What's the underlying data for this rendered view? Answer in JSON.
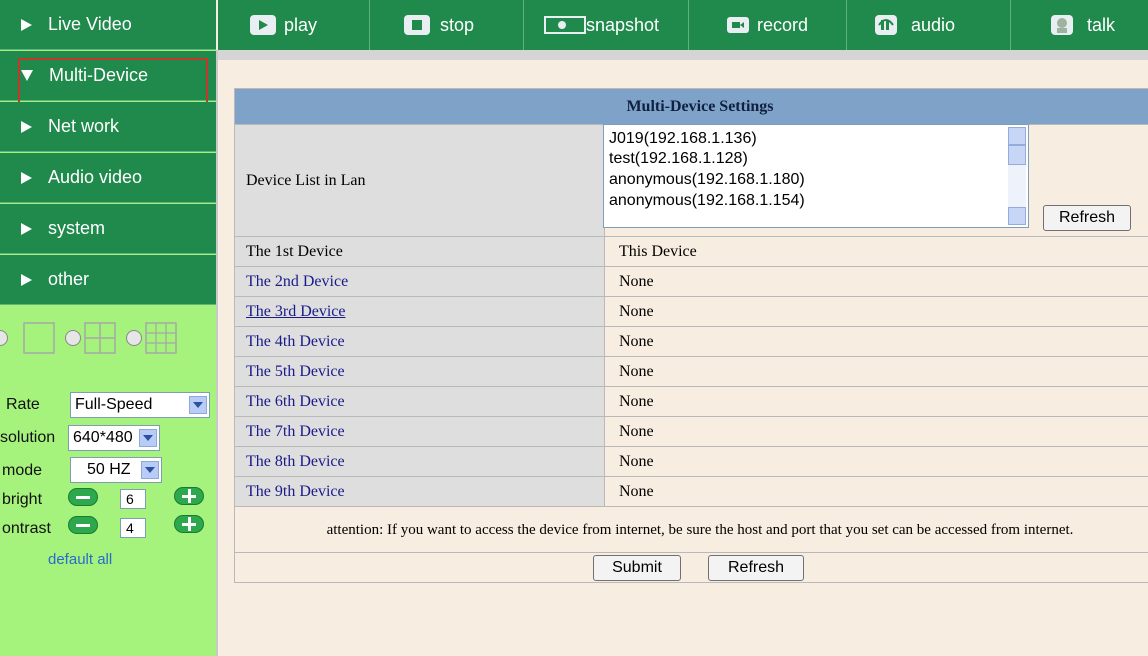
{
  "sidebar": {
    "nav": [
      {
        "label": "Live Video",
        "icon": "triangle-right-icon"
      },
      {
        "label": "Multi-Device",
        "icon": "triangle-down-icon"
      },
      {
        "label": "Net work",
        "icon": "triangle-right-icon"
      },
      {
        "label": "Audio video",
        "icon": "triangle-right-icon"
      },
      {
        "label": "system",
        "icon": "triangle-right-icon"
      },
      {
        "label": "other",
        "icon": "triangle-right-icon"
      }
    ],
    "controls": {
      "rate_label": "Rate",
      "rate_value": "Full-Speed",
      "resolution_label": "solution",
      "resolution_value": "640*480",
      "mode_label": "mode",
      "mode_value": "50 HZ",
      "bright_label": "bright",
      "bright_value": "6",
      "contrast_label": "ontrast",
      "contrast_value": "4",
      "default_all": "default all"
    }
  },
  "toolbar": {
    "play": "play",
    "stop": "stop",
    "snapshot": "snapshot",
    "record": "record",
    "audio": "audio",
    "talk": "talk"
  },
  "settings": {
    "title": "Multi-Device Settings",
    "device_list_label": "Device List in Lan",
    "lan_devices": [
      "J019(192.168.1.136)",
      "test(192.168.1.128)",
      "anonymous(192.168.1.180)",
      "anonymous(192.168.1.154)"
    ],
    "list_refresh": "Refresh",
    "devices": [
      {
        "label": "The 1st Device",
        "value": "This Device"
      },
      {
        "label": "The 2nd Device",
        "value": "None"
      },
      {
        "label": "The 3rd Device",
        "value": "None"
      },
      {
        "label": "The 4th Device",
        "value": "None"
      },
      {
        "label": "The 5th Device",
        "value": "None"
      },
      {
        "label": "The 6th Device",
        "value": "None"
      },
      {
        "label": "The 7th Device",
        "value": "None"
      },
      {
        "label": "The 8th Device",
        "value": "None"
      },
      {
        "label": "The 9th Device",
        "value": "None"
      }
    ],
    "attention": "attention: If you want to access the device from internet, be sure the host and port that you set can be accessed from internet.",
    "submit": "Submit",
    "refresh": "Refresh"
  },
  "colors": {
    "nav_green": "#1F8A4C",
    "sidebar_light_green": "#A5F27C",
    "header_blue": "#7FA3C8",
    "selection_outline": "#C0392B"
  }
}
